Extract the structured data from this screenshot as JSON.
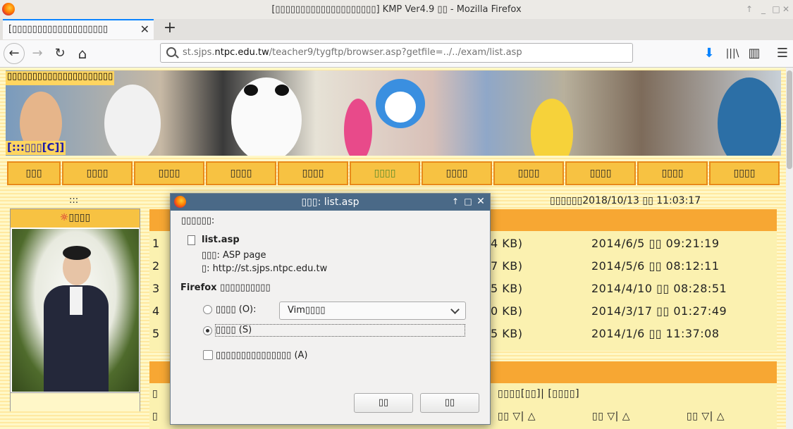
{
  "window": {
    "title": "[▯▯▯▯▯▯▯▯▯▯▯▯▯▯▯▯▯▯▯▯] KMP Ver4.9 ▯▯ - Mozilla Firefox"
  },
  "tab": {
    "label": "[▯▯▯▯▯▯▯▯▯▯▯▯▯▯▯▯▯▯▯",
    "close": "✕",
    "new_tab": "+"
  },
  "nav": {
    "back": "←",
    "forward": "→",
    "reload": "↻",
    "home": "⌂",
    "url_prefix": "st.sjps.",
    "url_domain": "ntpc.edu.tw",
    "url_path": "/teacher9/tygftp/browser.asp?getfile=../../exam/list.asp",
    "download": "⬇",
    "library": "|||\\",
    "sidebar": "▥",
    "menu": "☰"
  },
  "page": {
    "banner_title": "▯▯▯▯▯▯▯▯▯▯▯▯▯▯▯▯▯▯▯▯▯",
    "banner_sub": "[:::▯▯▯[C]]",
    "menu_items": [
      "▯▯▯",
      "▯▯▯▯",
      "▯▯▯▯",
      "▯▯▯▯",
      "▯▯▯▯",
      "▯▯▯▯",
      "▯▯▯▯",
      "▯▯▯▯",
      "▯▯▯▯",
      "▯▯▯▯",
      "▯▯▯▯"
    ],
    "colon_marker": ":::",
    "datetime": "▯▯▯▯▯▯2018/10/13 ▯▯ 11:03:17",
    "profile_title": "▯▯▯▯",
    "list_rows": [
      {
        "num": "1",
        "size": "4 KB)",
        "date": "2014/6/5 ▯▯ 09:21:19"
      },
      {
        "num": "2",
        "size": "7 KB)",
        "date": "2014/5/6 ▯▯ 08:12:11"
      },
      {
        "num": "3",
        "size": "5 KB)",
        "date": "2014/4/10 ▯▯ 08:28:51"
      },
      {
        "num": "4",
        "size": "0 KB)",
        "date": "2014/3/17 ▯▯ 01:27:49"
      },
      {
        "num": "5",
        "size": "5 KB)",
        "date": "2014/1/6 ▯▯ 11:37:08"
      }
    ],
    "list2_text1": "▯",
    "list2_text2": "▯▯▯▯[▯▯]| [▯▯▯▯]",
    "list2_text3": "▯",
    "list2_sort": [
      "▯▯ ▽| △",
      "▯▯ ▽| △",
      "▯▯ ▽| △"
    ]
  },
  "dialog": {
    "title": "▯▯▯: list.asp",
    "opening_label": "▯▯▯▯▯▯:",
    "file_name": "list.asp",
    "file_type": "▯▯▯: ASP page",
    "file_from": "▯: http://st.sjps.ntpc.edu.tw",
    "prompt": "Firefox ▯▯▯▯▯▯▯▯▯▯",
    "open_with_label": "▯▯▯▯ (O):",
    "open_with_app": "Vim▯▯▯▯",
    "save_label": "▯▯▯▯ (S)",
    "remember_label": "▯▯▯▯▯▯▯▯▯▯▯▯▯▯▯ (A)",
    "ok_button": "▯▯",
    "cancel_button": "▯▯"
  },
  "colors": {
    "accent": "#0a84ff",
    "dialog_title": "#4a6987",
    "menu_fill": "#f7c242",
    "menu_border": "#e88a1a",
    "list_head": "#f7a733"
  }
}
